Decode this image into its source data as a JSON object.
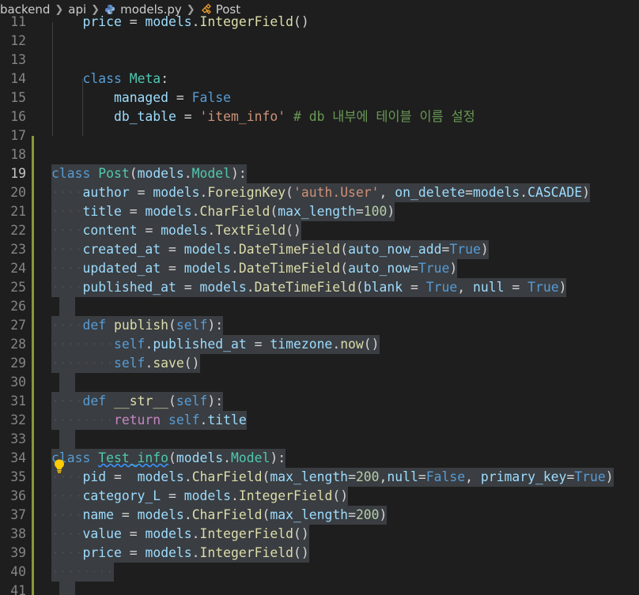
{
  "breadcrumb": {
    "items": [
      "backend",
      "api",
      "models.py",
      "Post"
    ],
    "separator": ">"
  },
  "colors": {
    "background": "#1e1e1e",
    "selection": "#3a3d41",
    "keyword": "#569cd6",
    "class_name": "#4ec9b0",
    "function": "#dcdcaa",
    "parameter": "#9cdcfe",
    "string": "#ce9178",
    "number": "#b5cea8",
    "comment": "#6a9955",
    "git_modified": "#8a9a3a"
  },
  "icons": [
    "python-file-icon",
    "class-symbol-icon",
    "lightbulb-icon"
  ],
  "editor": {
    "active_line": 19,
    "lines": [
      {
        "n": "11",
        "text": "    price = models.IntegerField()"
      },
      {
        "n": "12",
        "text": ""
      },
      {
        "n": "13",
        "text": ""
      },
      {
        "n": "14",
        "text": "    class Meta:"
      },
      {
        "n": "15",
        "text": "        managed = False"
      },
      {
        "n": "16",
        "text": "        db_table = 'item_info' # db 내부에 테이블 이름 설정"
      },
      {
        "n": "17",
        "text": ""
      },
      {
        "n": "18",
        "text": ""
      },
      {
        "n": "19",
        "text": "class Post(models.Model):"
      },
      {
        "n": "20",
        "text": "····author = models.ForeignKey('auth.User', on_delete=models.CASCADE)"
      },
      {
        "n": "21",
        "text": "····title = models.CharField(max_length=100)"
      },
      {
        "n": "22",
        "text": "····content = models.TextField()"
      },
      {
        "n": "23",
        "text": "····created_at = models.DateTimeField(auto_now_add=True)"
      },
      {
        "n": "24",
        "text": "····updated_at = models.DateTimeField(auto_now=True)"
      },
      {
        "n": "25",
        "text": "····published_at = models.DateTimeField(blank = True, null = True)"
      },
      {
        "n": "26",
        "text": ""
      },
      {
        "n": "27",
        "text": "····def publish(self):"
      },
      {
        "n": "28",
        "text": "········self.published_at = timezone.now()"
      },
      {
        "n": "29",
        "text": "········self.save()"
      },
      {
        "n": "30",
        "text": ""
      },
      {
        "n": "31",
        "text": "····def __str__(self):"
      },
      {
        "n": "32",
        "text": "········return self.title"
      },
      {
        "n": "33",
        "text": ""
      },
      {
        "n": "34",
        "text": "class Test_info(models.Model):"
      },
      {
        "n": "35",
        "text": "····pid =  models.CharField(max_length=200,null=False, primary_key=True)"
      },
      {
        "n": "36",
        "text": "····category_L = models.IntegerField()"
      },
      {
        "n": "37",
        "text": "····name = models.CharField(max_length=200)"
      },
      {
        "n": "38",
        "text": "····value = models.IntegerField()"
      },
      {
        "n": "39",
        "text": "····price = models.IntegerField()"
      },
      {
        "n": "40",
        "text": "········"
      },
      {
        "n": "41",
        "text": ""
      }
    ]
  }
}
